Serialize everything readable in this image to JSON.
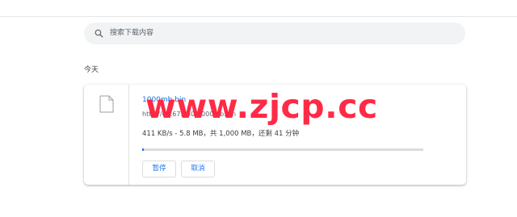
{
  "search": {
    "placeholder": "搜索下载内容",
    "icon": "search-icon"
  },
  "section": {
    "title": "今天"
  },
  "download": {
    "file_name": "1000mb.bin",
    "url": "http://45.67.230/1000mb.bin",
    "status": "411 KB/s - 5.8 MB，共 1,000 MB，还剩 41 分钟",
    "progress": 0.0058,
    "file_icon": "file-icon",
    "buttons": {
      "pause": "暂停",
      "cancel": "取消"
    }
  },
  "watermark": {
    "text": "www.zjcp.cc"
  },
  "colors": {
    "accent": "#1a73e8",
    "watermark": "#ff1f3d",
    "search_bg": "#f1f3f4"
  }
}
